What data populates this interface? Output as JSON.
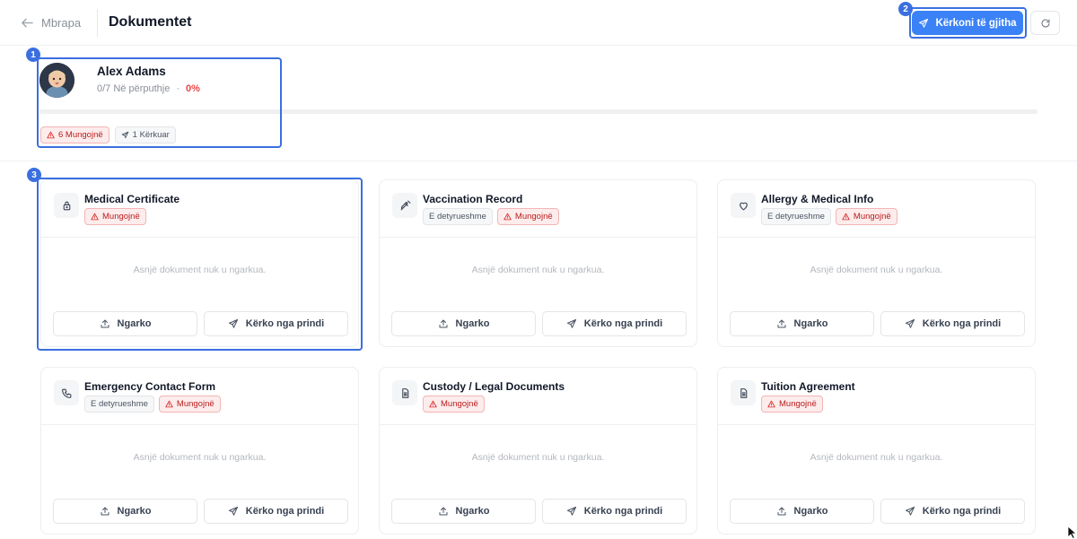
{
  "header": {
    "back_label": "Mbrapa",
    "title": "Dokumentet",
    "request_all_label": "Kërkoni të gjitha",
    "refresh_icon": "refresh-icon"
  },
  "profile": {
    "name": "Alex Adams",
    "match_text": "0/7 Në përputhje",
    "separator": "·",
    "percent_text": "0%",
    "progress_percent": 0,
    "missing_badge": "6 Mungojnë",
    "requested_badge": "1 Kërkuar"
  },
  "annotations": {
    "marker_1": "1",
    "marker_2": "2",
    "marker_3": "3"
  },
  "labels": {
    "required": "E detyrueshme",
    "missing": "Mungojnë",
    "empty": "Asnjë dokument nuk u ngarkua.",
    "upload": "Ngarko",
    "request_parent": "Kërko nga prindi"
  },
  "documents": [
    {
      "title": "Medical Certificate",
      "icon": "lock-icon"
    },
    {
      "title": "Vaccination Record",
      "icon": "syringe-icon"
    },
    {
      "title": "Allergy & Medical Info",
      "icon": "heart-icon"
    },
    {
      "title": "Emergency Contact Form",
      "icon": "phone-icon"
    },
    {
      "title": "Custody / Legal Documents",
      "icon": "document-icon"
    },
    {
      "title": "Tuition Agreement",
      "icon": "document-icon"
    }
  ],
  "colors": {
    "accent": "#3b82f6",
    "highlight": "#3b6fe0",
    "missing": "#ef4444"
  }
}
